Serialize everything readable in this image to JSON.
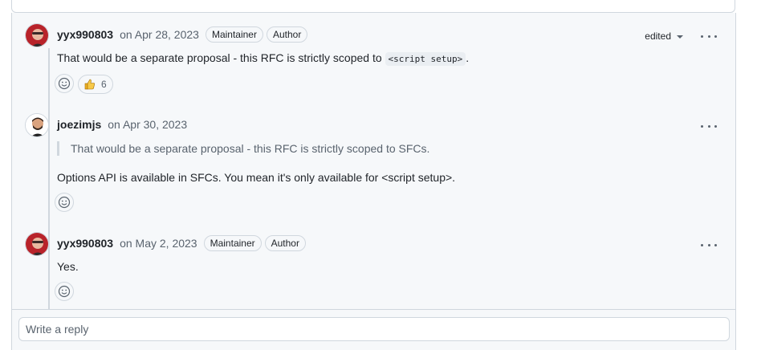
{
  "comments": [
    {
      "author": "yyx990803",
      "date": "on Apr 28, 2023",
      "badges": [
        "Maintainer",
        "Author"
      ],
      "edited_label": "edited",
      "body_prefix": "That would be a separate proposal - this RFC is strictly scoped to ",
      "body_code": "<script setup>",
      "body_suffix": ".",
      "reactions": [
        {
          "emoji": "thumbs-up",
          "count": "6"
        }
      ]
    },
    {
      "author": "joezimjs",
      "date": "on Apr 30, 2023",
      "quote": "That would be a separate proposal - this RFC is strictly scoped to SFCs.",
      "body": "Options API is available in SFCs. You mean it's only available for <script setup>."
    },
    {
      "author": "yyx990803",
      "date": "on May 2, 2023",
      "badges": [
        "Maintainer",
        "Author"
      ],
      "body": "Yes."
    }
  ],
  "reply": {
    "placeholder": "Write a reply"
  },
  "colors": {
    "border": "#d0d7de",
    "thread_bg": "#f6f8fa",
    "muted": "#59636e",
    "text": "#1f2328"
  }
}
